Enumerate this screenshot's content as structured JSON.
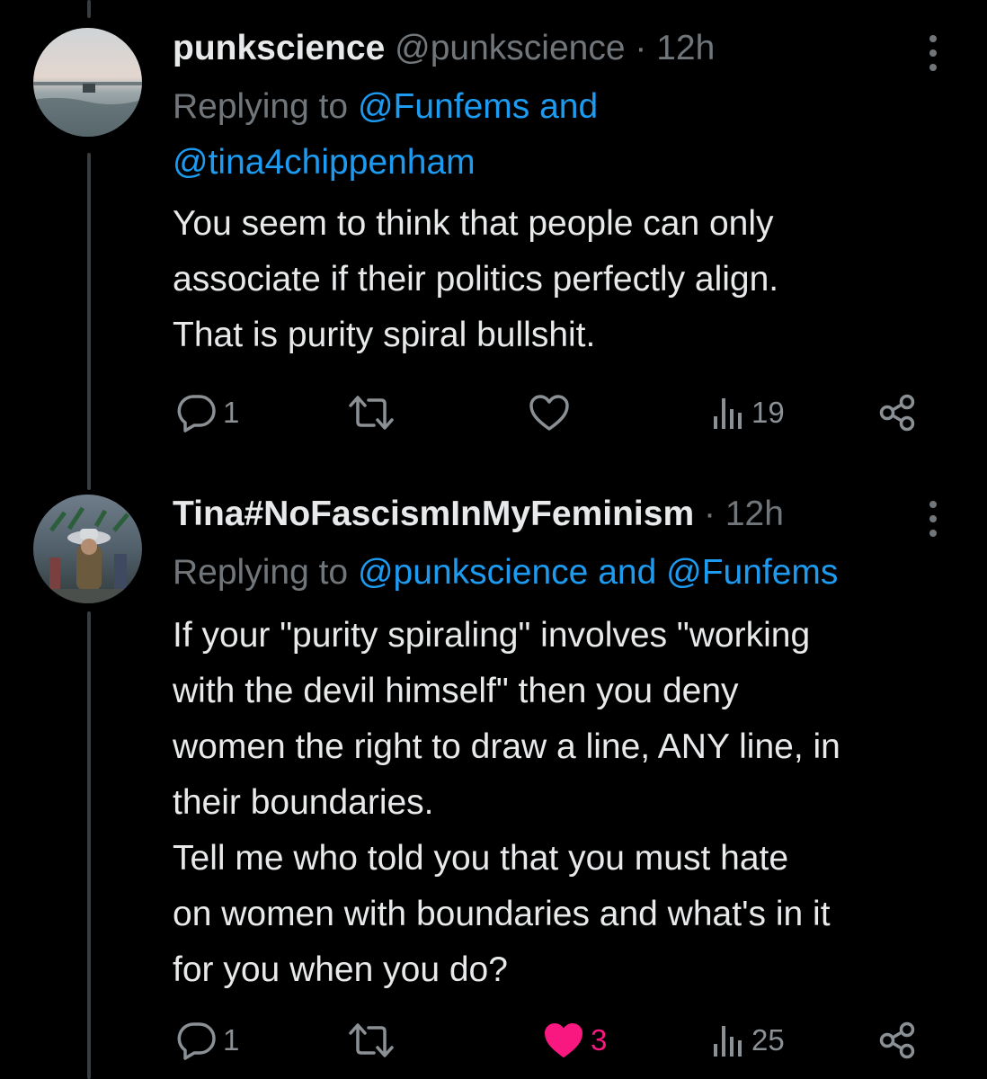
{
  "tweets": [
    {
      "display_name": "punkscience",
      "handle": "@punkscience",
      "separator": "·",
      "time": "12h",
      "replying_prefix": "Replying to",
      "reply_line_1_links": "@Funfems and",
      "reply_line_2_links": "@tina4chippenham",
      "text": "You seem to think that people can only\nassociate if their politics perfectly align.\nThat is purity spiral bullshit.",
      "reply_count": "1",
      "retweet_count": "",
      "like_count": "",
      "view_count": "19",
      "liked": false
    },
    {
      "display_name": "Tina#NoFascismInMyFeminism",
      "separator": "·",
      "time": "12h",
      "replying_prefix": "Replying to",
      "reply_line_1_links": "@punkscience and @Funfems",
      "text": "If your \"purity spiraling\" involves \"working\nwith the devil himself\" then you deny\nwomen the right to draw a line, ANY line, in\ntheir boundaries.\nTell me who told you that you must hate\non women with boundaries and what's in it\nfor you when you do?",
      "reply_count": "1",
      "retweet_count": "",
      "like_count": "3",
      "view_count": "25",
      "liked": true
    }
  ],
  "icons": {
    "reply": "reply-icon",
    "retweet": "retweet-icon",
    "like": "heart-icon",
    "views": "views-icon",
    "share": "share-icon",
    "more": "more-options-icon"
  },
  "colors": {
    "background": "#000000",
    "text": "#e7e9ea",
    "muted": "#71767b",
    "link": "#1d9bf0",
    "like_active": "#f91880"
  }
}
